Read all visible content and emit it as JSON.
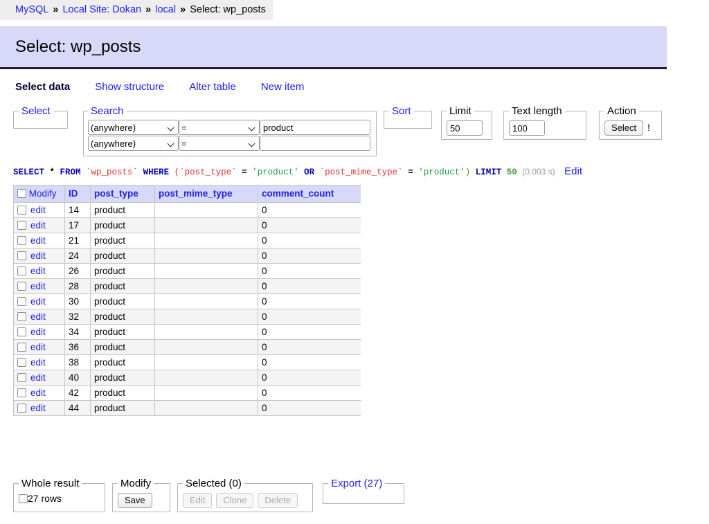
{
  "breadcrumb": {
    "separator": "»",
    "items": [
      {
        "label": "MySQL",
        "link": true
      },
      {
        "label": "Local Site: Dokan",
        "link": true
      },
      {
        "label": "local",
        "link": true
      },
      {
        "label": "Select: wp_posts",
        "link": false
      }
    ]
  },
  "header": {
    "title": "Select: wp_posts"
  },
  "tabs": [
    {
      "label": "Select data",
      "active": true
    },
    {
      "label": "Show structure",
      "active": false
    },
    {
      "label": "Alter table",
      "active": false
    },
    {
      "label": "New item",
      "active": false
    }
  ],
  "form": {
    "select": {
      "legend": "Select"
    },
    "search": {
      "legend": "Search",
      "rows": [
        {
          "field": "(anywhere)",
          "operator": "=",
          "value": "product",
          "placeholder": ""
        },
        {
          "field": "(anywhere)",
          "operator": "=",
          "value": "",
          "placeholder": ""
        }
      ]
    },
    "sort": {
      "legend": "Sort"
    },
    "limit": {
      "legend": "Limit",
      "value": "50"
    },
    "text_length": {
      "legend": "Text length",
      "value": "100"
    },
    "action": {
      "legend": "Action",
      "select_label": "Select",
      "bang": "!"
    }
  },
  "sql": {
    "tokens": [
      {
        "t": "SELECT",
        "c": "kw"
      },
      {
        "t": "*",
        "c": "pun"
      },
      {
        "t": "FROM",
        "c": "kw"
      },
      {
        "t": "`wp_posts`",
        "c": "idn"
      },
      {
        "t": "WHERE",
        "c": "kw"
      },
      {
        "t": "(`post_type`",
        "c": "idn"
      },
      {
        "t": "=",
        "c": "pun"
      },
      {
        "t": "'product'",
        "c": "str"
      },
      {
        "t": "OR",
        "c": "kw"
      },
      {
        "t": "`post_mime_type`",
        "c": "idn"
      },
      {
        "t": "=",
        "c": "pun"
      },
      {
        "t": "'product')",
        "c": "str"
      },
      {
        "t": "LIMIT",
        "c": "kw"
      },
      {
        "t": "50",
        "c": "num"
      }
    ],
    "text": "SELECT * FROM `wp_posts` WHERE (`post_type` = 'product' OR `post_mime_type` = 'product') LIMIT 50",
    "duration": "(0.003 s)",
    "edit_label": "Edit"
  },
  "table": {
    "columns": [
      "Modify",
      "ID",
      "post_type",
      "post_mime_type",
      "comment_count"
    ],
    "row_action_label": "edit",
    "rows": [
      {
        "id": "14",
        "post_type": "product",
        "post_mime_type": "",
        "comment_count": "0"
      },
      {
        "id": "17",
        "post_type": "product",
        "post_mime_type": "",
        "comment_count": "0"
      },
      {
        "id": "21",
        "post_type": "product",
        "post_mime_type": "",
        "comment_count": "0"
      },
      {
        "id": "24",
        "post_type": "product",
        "post_mime_type": "",
        "comment_count": "0"
      },
      {
        "id": "26",
        "post_type": "product",
        "post_mime_type": "",
        "comment_count": "0"
      },
      {
        "id": "28",
        "post_type": "product",
        "post_mime_type": "",
        "comment_count": "0"
      },
      {
        "id": "30",
        "post_type": "product",
        "post_mime_type": "",
        "comment_count": "0"
      },
      {
        "id": "32",
        "post_type": "product",
        "post_mime_type": "",
        "comment_count": "0"
      },
      {
        "id": "34",
        "post_type": "product",
        "post_mime_type": "",
        "comment_count": "0"
      },
      {
        "id": "36",
        "post_type": "product",
        "post_mime_type": "",
        "comment_count": "0"
      },
      {
        "id": "38",
        "post_type": "product",
        "post_mime_type": "",
        "comment_count": "0"
      },
      {
        "id": "40",
        "post_type": "product",
        "post_mime_type": "",
        "comment_count": "0"
      },
      {
        "id": "42",
        "post_type": "product",
        "post_mime_type": "",
        "comment_count": "0"
      },
      {
        "id": "44",
        "post_type": "product",
        "post_mime_type": "",
        "comment_count": "0"
      }
    ]
  },
  "footer": {
    "whole_result": {
      "legend": "Whole result",
      "checkbox_label": "27 rows"
    },
    "modify": {
      "legend": "Modify",
      "save_label": "Save"
    },
    "selected": {
      "legend": "Selected (0)",
      "edit_label": "Edit",
      "clone_label": "Clone",
      "delete_label": "Delete"
    },
    "export": {
      "legend": "Export (27)"
    }
  },
  "colors": {
    "link": "#2020ee",
    "banner": "#d8d8f8",
    "header_bg": "#eeeeee",
    "sql_keyword": "#0000c0",
    "sql_identifier": "#e03030",
    "sql_string": "#1e9e3c"
  }
}
